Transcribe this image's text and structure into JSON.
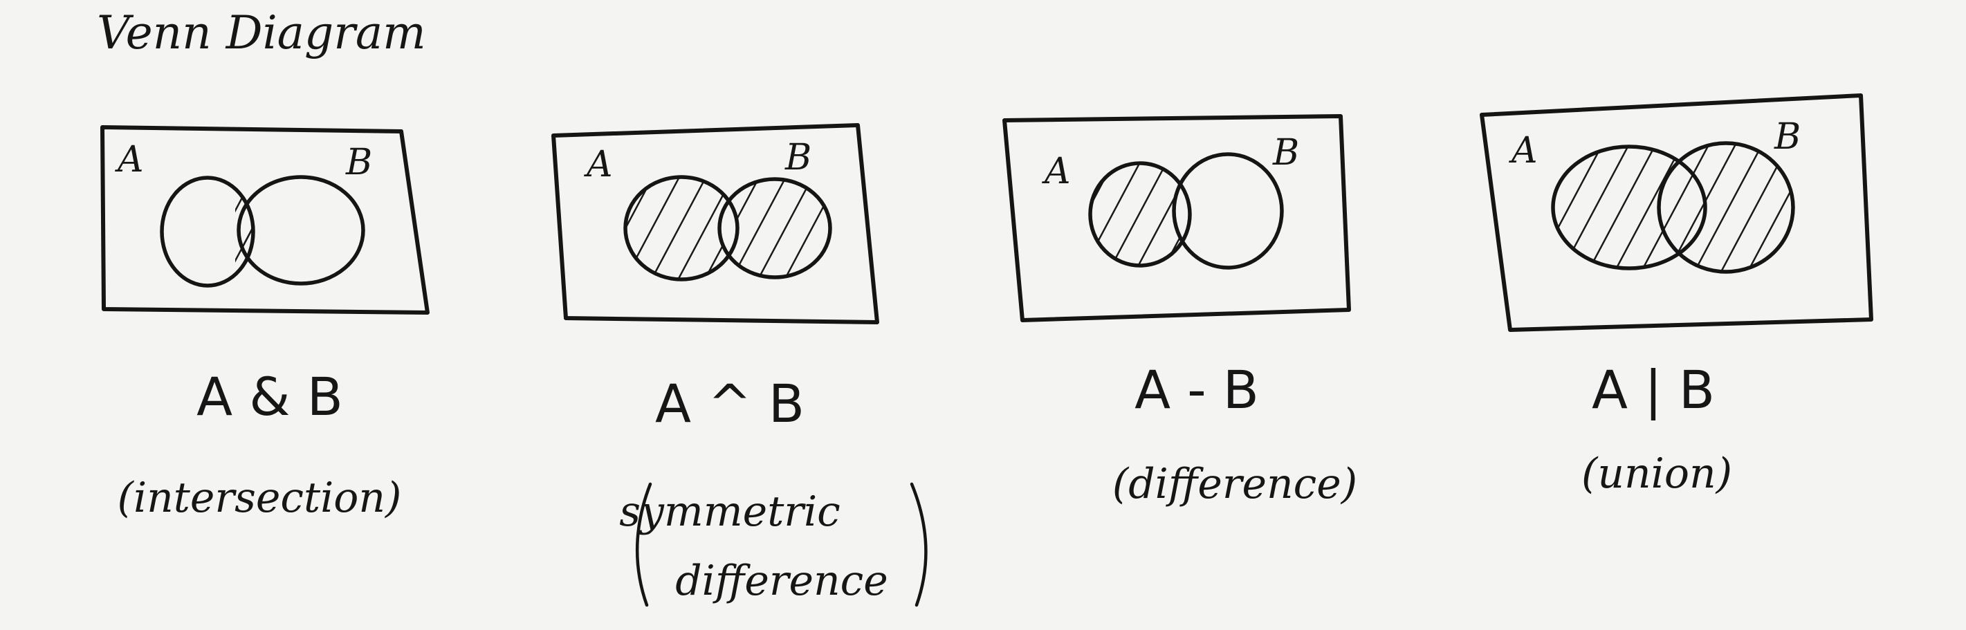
{
  "title": "Venn Diagram",
  "panels": [
    {
      "set_a": "A",
      "set_b": "B",
      "operation": "A & B",
      "name": "(intersection)",
      "shaded_region": "intersection"
    },
    {
      "set_a": "A",
      "set_b": "B",
      "operation": "A ^ B",
      "name_line1": "symmetric",
      "name_line2": "difference",
      "shaded_region": "symmetric-difference"
    },
    {
      "set_a": "A",
      "set_b": "B",
      "operation": "A - B",
      "name": "(difference)",
      "shaded_region": "a-only"
    },
    {
      "set_a": "A",
      "set_b": "B",
      "operation": "A | B",
      "name": "(union)",
      "shaded_region": "union"
    }
  ]
}
